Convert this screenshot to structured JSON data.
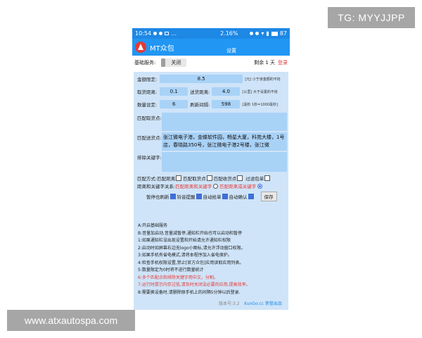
{
  "watermarks": {
    "top": "TG: MYYJJPP",
    "bottom": "www.atxautospa.com"
  },
  "statusbar": {
    "time": "10:54",
    "speed": "2.16",
    "percent_sign": "%",
    "battery": "87"
  },
  "app": {
    "title": "MT众包",
    "page_title": "设置"
  },
  "basic": {
    "label": "基础服务:",
    "toggle": "关闭",
    "remaining": "剩余 1 天",
    "login": "登录"
  },
  "fields": {
    "amount_label": "金额限定:",
    "amount_value": "8.5",
    "amount_hint": "[元] 小于该金额的不抢",
    "pickup_label": "取货距离:",
    "pickup_value": "0.1",
    "delivery_label": "送货距离:",
    "delivery_value": "4.0",
    "delivery_hint": "[公里] 大于设置的不抢",
    "count_label": "数量设定:",
    "count_value": "6",
    "refresh_label": "刷新间隔:",
    "refresh_value": "598",
    "refresh_hint": "[毫秒 1秒=1000毫秒]"
  },
  "match_pickup": {
    "label": "匹配取货点:",
    "value": ""
  },
  "match_delivery": {
    "label": "匹配送货点:",
    "value": "张江微电子港，金蝶软件园，畅星大厦，科苑大楼，1号店，春晓路350号，张江微电子港2号楼，张江微"
  },
  "exclude": {
    "label": "排除关键字:",
    "value": ""
  },
  "match_mode": {
    "label": "匹配方式:",
    "opt1": "匹配距离",
    "opt2": "匹配取货点",
    "opt3": "匹配收货点",
    "opt4": "过滤包单"
  },
  "relation": {
    "label": "距离和关键字关系:",
    "opt1": "匹配距离和关键字",
    "opt2": "匹配距离或关键字"
  },
  "actions": {
    "opt1": "暂停也刷新",
    "opt2": "铃音提醒",
    "opt3": "自动抢单",
    "opt4": "自动确认",
    "save": "保存"
  },
  "notes": [
    "A:开启基础服务",
    "B:音量加启动,音量减暂停,通知栏开始也可以启动和暂停",
    "1:如果通知栏没出现设置和开始请允许通知栏权限",
    "2:启动时如屏幕右边无logo小图标,请允许浮动窗口权限。",
    "3:如果手机有省电模式,请将本程序加入省电保护。",
    "4:检查手机权限设置,禁止[官方众包]应用读取应用列表。",
    "5:数量限定为0时将不进行数量统计",
    "6:多个匹配点和排除关键字用中文，分割。",
    "7:运行时提示内存过低,请及时关闭没必要的应用,提高效率。",
    "8:需要换设备时,请删除原手机上的间隔5分钟以后登录."
  ],
  "footer": {
    "version": "版本号:3.2",
    "site": "XunGo.cc 荣誉出品"
  }
}
